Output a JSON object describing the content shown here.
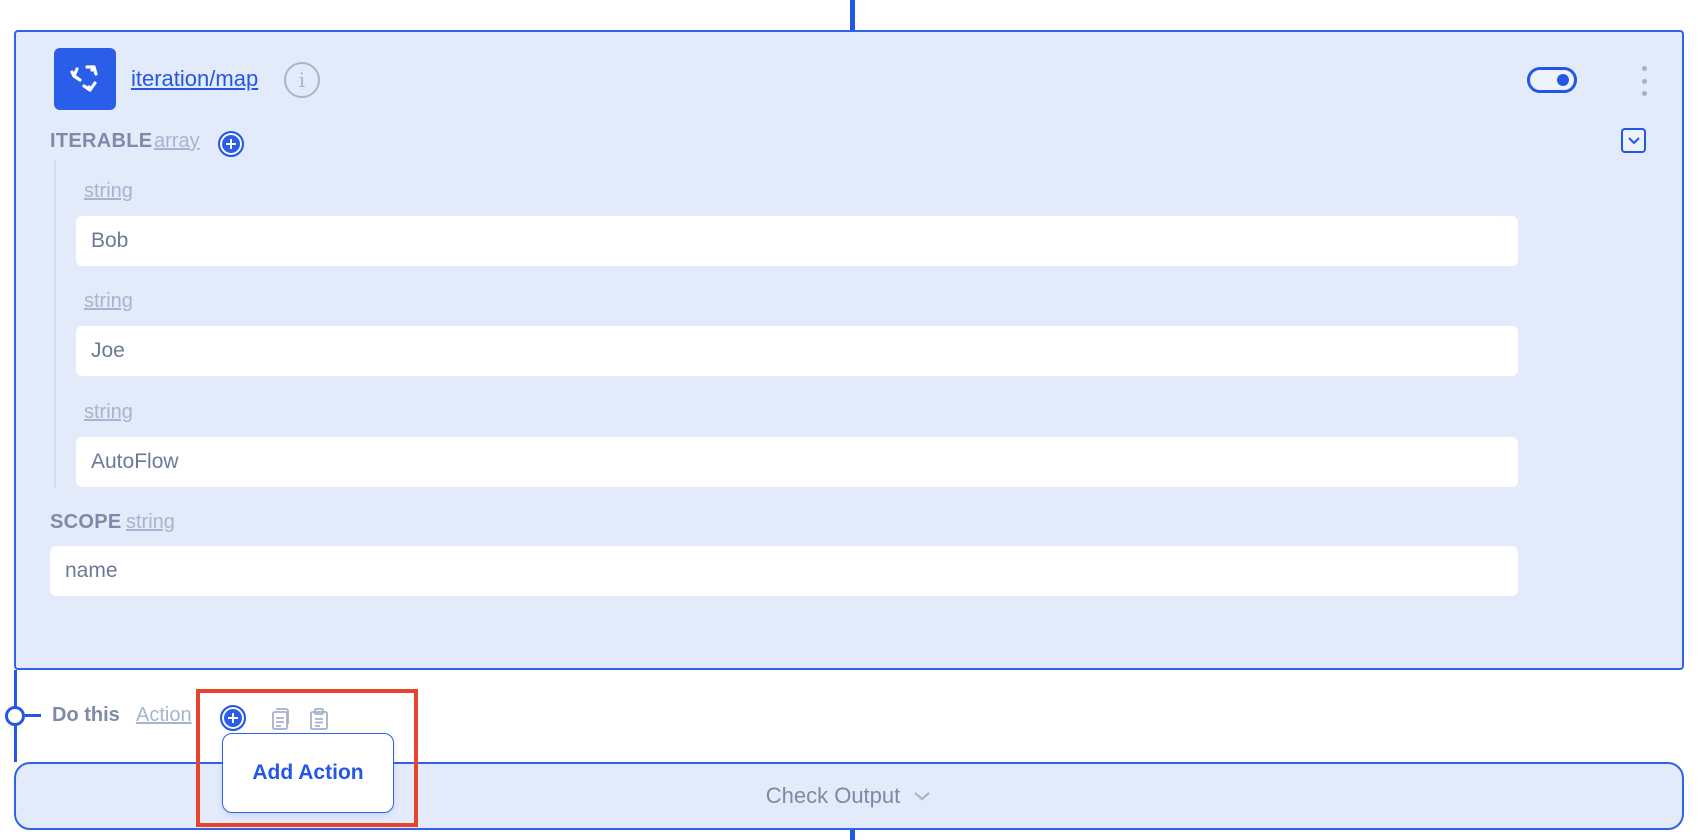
{
  "node": {
    "title": "iteration/map",
    "enabled": true
  },
  "iterable": {
    "label": "ITERABLE",
    "type": "array",
    "items": [
      {
        "type": "string",
        "value": "Bob"
      },
      {
        "type": "string",
        "value": "Joe"
      },
      {
        "type": "string",
        "value": "AutoFlow"
      }
    ]
  },
  "scope": {
    "label": "SCOPE",
    "type": "string",
    "value": "name"
  },
  "do_this": {
    "label": "Do this",
    "type": "Action"
  },
  "popup": {
    "add_action_label": "Add Action"
  },
  "check_output": {
    "label": "Check Output"
  },
  "colors": {
    "accent": "#2457e8",
    "card_bg": "#e3eaf9",
    "highlight": "#e8432c"
  },
  "icons": [
    "loop-icon",
    "info-icon",
    "toggle-switch",
    "kebab-menu-icon",
    "plus-circle-icon",
    "chevron-down-icon",
    "copy-icon",
    "paste-icon"
  ]
}
